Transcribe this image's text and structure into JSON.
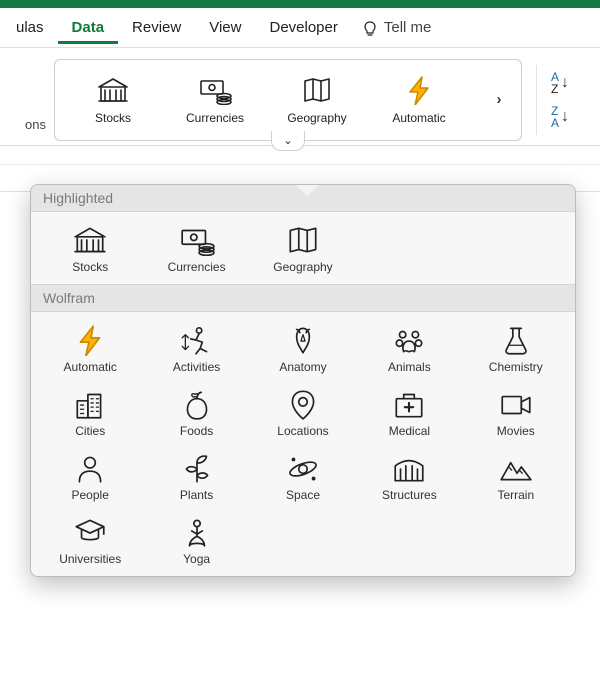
{
  "tabs": {
    "t0": "ulas",
    "t1": "Data",
    "t2": "Review",
    "t3": "View",
    "t4": "Developer",
    "tellme": "Tell me"
  },
  "ribbon": {
    "left_fragment": "ons",
    "stocks": "Stocks",
    "currencies": "Currencies",
    "geography": "Geography",
    "automatic": "Automatic",
    "sort_az_top": "A",
    "sort_az_bot": "Z",
    "sort_za_top": "Z",
    "sort_za_bot": "A"
  },
  "panel": {
    "section_highlighted": "Highlighted",
    "section_wolfram": "Wolfram",
    "highlighted": {
      "stocks": "Stocks",
      "currencies": "Currencies",
      "geography": "Geography"
    },
    "wolfram": {
      "automatic": "Automatic",
      "activities": "Activities",
      "anatomy": "Anatomy",
      "animals": "Animals",
      "chemistry": "Chemistry",
      "cities": "Cities",
      "foods": "Foods",
      "locations": "Locations",
      "medical": "Medical",
      "movies": "Movies",
      "people": "People",
      "plants": "Plants",
      "space": "Space",
      "structures": "Structures",
      "terrain": "Terrain",
      "universities": "Universities",
      "yoga": "Yoga"
    }
  }
}
